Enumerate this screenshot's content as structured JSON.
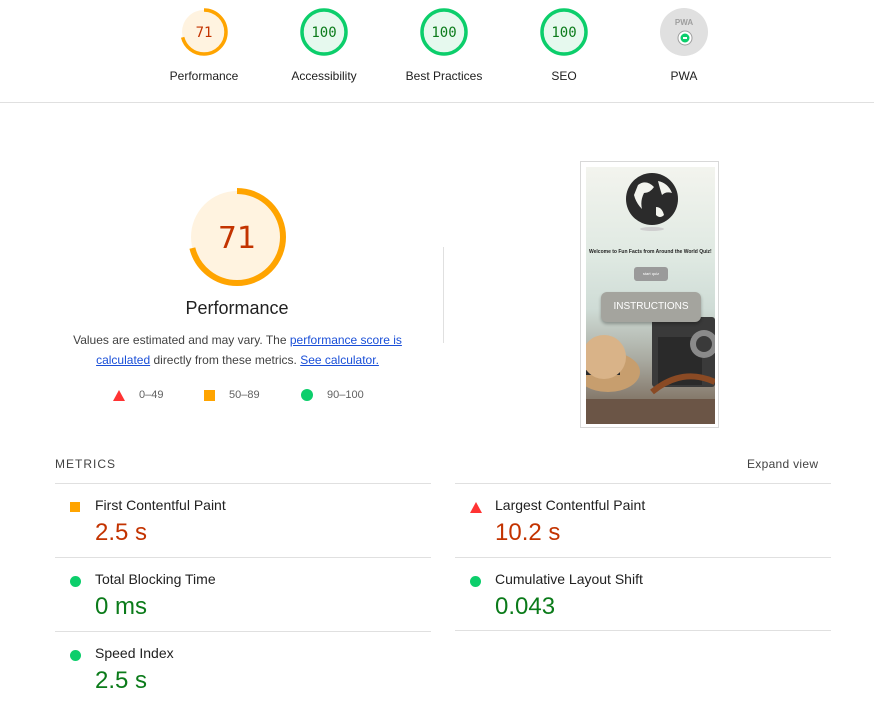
{
  "colors": {
    "fail": "#ff3333",
    "average": "#ffa400",
    "pass": "#0cce6b",
    "pass_text": "#0b7b1a",
    "fail_text": "#c33300",
    "average_text": "#c33300"
  },
  "categories": [
    {
      "label": "Performance",
      "score": "71",
      "level": 0.71,
      "status": "average"
    },
    {
      "label": "Accessibility",
      "score": "100",
      "level": 1.0,
      "status": "pass"
    },
    {
      "label": "Best Practices",
      "score": "100",
      "level": 1.0,
      "status": "pass"
    },
    {
      "label": "SEO",
      "score": "100",
      "level": 1.0,
      "status": "pass"
    },
    {
      "label": "PWA",
      "badge_text": "PWA",
      "icon": "pwa-badge-icon"
    }
  ],
  "performance": {
    "score": "71",
    "level": 0.71,
    "title": "Performance",
    "desc_prefix": "Values are estimated and may vary. The ",
    "desc_link1": "performance score is calculated",
    "desc_middle": " directly from these metrics. ",
    "desc_link2": "See calculator."
  },
  "legend": [
    {
      "range": "0–49",
      "shape": "triangle",
      "status": "fail"
    },
    {
      "range": "50–89",
      "shape": "square",
      "status": "average"
    },
    {
      "range": "90–100",
      "shape": "circle",
      "status": "pass"
    }
  ],
  "screenshot": {
    "heading": "Welcome to Fun Facts from Around the World Quiz!",
    "small_button": "start quiz",
    "big_button": "INSTRUCTIONS"
  },
  "metrics_header": "METRICS",
  "expand_label": "Expand view",
  "metrics": [
    {
      "name": "First Contentful Paint",
      "value": "2.5 s",
      "status": "average"
    },
    {
      "name": "Largest Contentful Paint",
      "value": "10.2 s",
      "status": "fail"
    },
    {
      "name": "Total Blocking Time",
      "value": "0 ms",
      "status": "pass"
    },
    {
      "name": "Cumulative Layout Shift",
      "value": "0.043",
      "status": "pass"
    },
    {
      "name": "Speed Index",
      "value": "2.5 s",
      "status": "pass"
    }
  ]
}
